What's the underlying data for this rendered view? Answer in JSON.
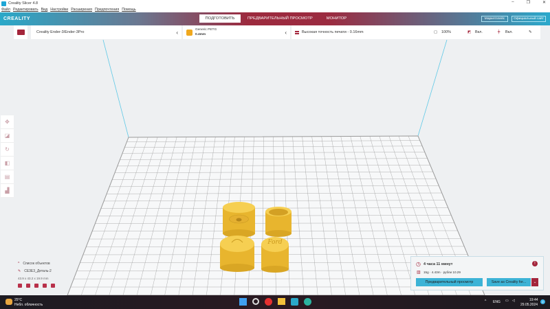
{
  "window": {
    "title": "Creality Slicer 4.8",
    "controls": [
      "–",
      "❐",
      "✕"
    ]
  },
  "menu": [
    "Файл",
    "Редактировать",
    "Вид",
    "Настройки",
    "Расширения",
    "Предпочтения",
    "Помощь"
  ],
  "header": {
    "brand": "CREALITY",
    "tabs": [
      "ПОДГОТОВИТЬ",
      "ПРЕДВАРИТЕЛЬНЫЙ ПРОСМОТР",
      "МОНИТОР"
    ],
    "marketplace": "Маркетплейс",
    "official_site": "Официальный сайт"
  },
  "printer": {
    "name": "Creality Ender-3/Ender-3Pro"
  },
  "material": {
    "name": "Generic PETG",
    "nozzle": "0.4mm"
  },
  "profile": {
    "name": "Высокая точность печати - 0.16mm",
    "infill": "100%",
    "support": "Вкл.",
    "adhesion": "Вкл."
  },
  "objects": {
    "toggle": "Список объектов",
    "name": "CE3E3_Деталь-2",
    "dims": "43.9 x 43.2 x 19.9 mm"
  },
  "estimate": {
    "time": "4 часа 11 минут",
    "material": "15g · 4.43m · рубли 10.29",
    "preview_button": "Предварительный просмотр",
    "save_button": "Save as Creality for..."
  },
  "taskbar": {
    "temp": "25°C",
    "weather": "Небл. облачность",
    "lang": "ENG",
    "time": "19:44",
    "date": "29.05.2024",
    "badge": "2"
  },
  "colors": {
    "accent": "#3cb3d6",
    "brand": "#9b2b40",
    "model": "#f4c643"
  }
}
